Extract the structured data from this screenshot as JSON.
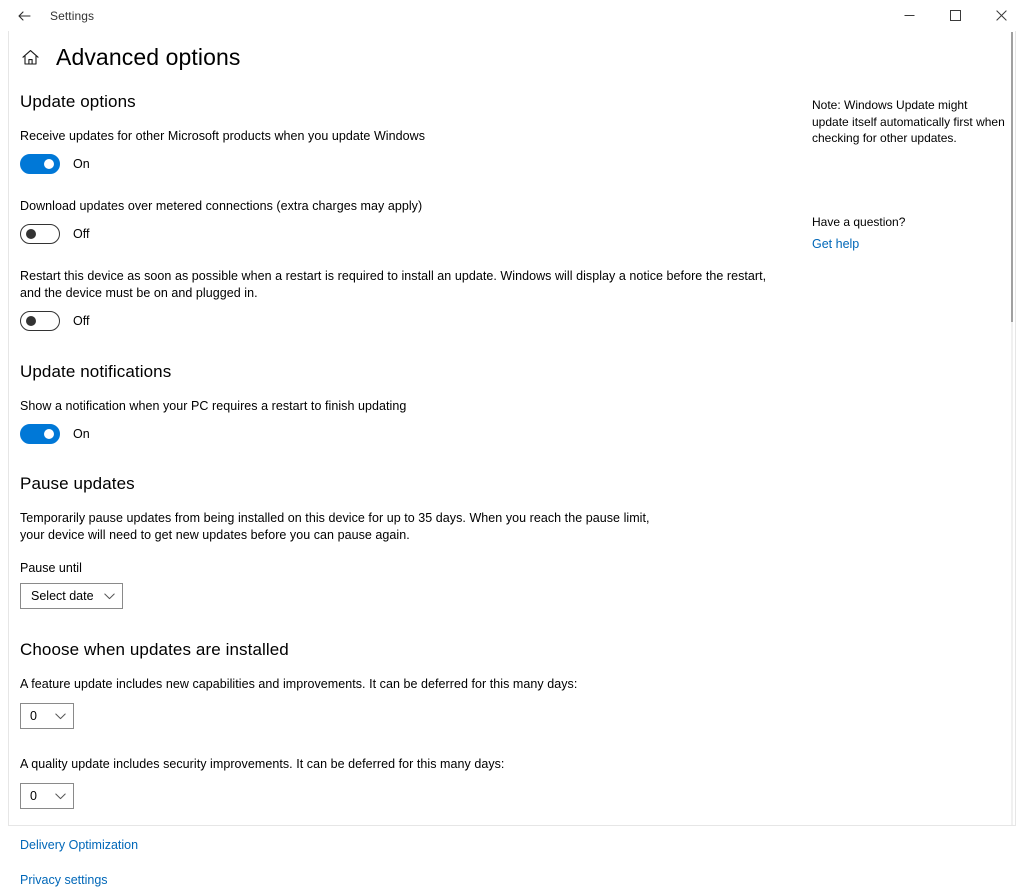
{
  "window": {
    "app_title": "Settings",
    "back_icon": "back-arrow-icon",
    "minimize_icon": "minimize-icon",
    "maximize_icon": "maximize-icon",
    "close_icon": "close-icon"
  },
  "header": {
    "home_icon": "home-icon",
    "page_title": "Advanced options"
  },
  "update_options": {
    "heading": "Update options",
    "settings": [
      {
        "label": "Receive updates for other Microsoft products when you update Windows",
        "state": "On",
        "on": true
      },
      {
        "label": "Download updates over metered connections (extra charges may apply)",
        "state": "Off",
        "on": false
      },
      {
        "label": "Restart this device as soon as possible when a restart is required to install an update. Windows will display a notice before the restart, and the device must be on and plugged in.",
        "state": "Off",
        "on": false
      }
    ]
  },
  "update_notifications": {
    "heading": "Update notifications",
    "setting": {
      "label": "Show a notification when your PC requires a restart to finish updating",
      "state": "On",
      "on": true
    }
  },
  "pause_updates": {
    "heading": "Pause updates",
    "description": "Temporarily pause updates from being installed on this device for up to 35 days. When you reach the pause limit, your device will need to get new updates before you can pause again.",
    "field_label": "Pause until",
    "dropdown_value": "Select date"
  },
  "choose_when": {
    "heading": "Choose when updates are installed",
    "feature_label": "A feature update includes new capabilities and improvements. It can be deferred for this many days:",
    "feature_value": "0",
    "quality_label": "A quality update includes security improvements. It can be deferred for this many days:",
    "quality_value": "0"
  },
  "links": {
    "delivery_optimization": "Delivery Optimization",
    "privacy_settings": "Privacy settings"
  },
  "sidebar": {
    "note": "Note: Windows Update might update itself automatically first when checking for other updates.",
    "question": "Have a question?",
    "get_help": "Get help"
  },
  "colors": {
    "accent": "#0078d7",
    "link": "#0067b8"
  }
}
